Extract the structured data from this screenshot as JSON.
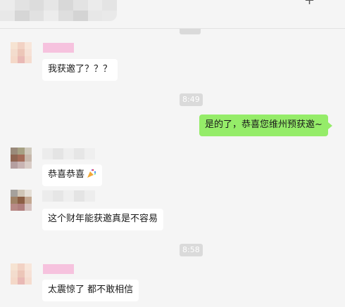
{
  "header": {
    "add_icon_glyph": "+"
  },
  "messages": [
    {
      "side": "them",
      "text": "我获邀了？？？"
    },
    {
      "side": "time",
      "text": "8:49"
    },
    {
      "side": "me",
      "text": "是的了，恭喜您维州预获邀~"
    },
    {
      "side": "them",
      "text": "恭喜恭喜"
    },
    {
      "side": "them",
      "text": "这个财年能获邀真是不容易"
    },
    {
      "side": "time",
      "text": "8:58"
    },
    {
      "side": "them",
      "text": "太震惊了 都不敢相信"
    }
  ],
  "colors": {
    "background": "#f5f5f5",
    "bubble_me": "#95ec69",
    "bubble_them": "#ffffff",
    "time_badge": "#dadada",
    "name_redaction_pink": "#f6c2de"
  }
}
